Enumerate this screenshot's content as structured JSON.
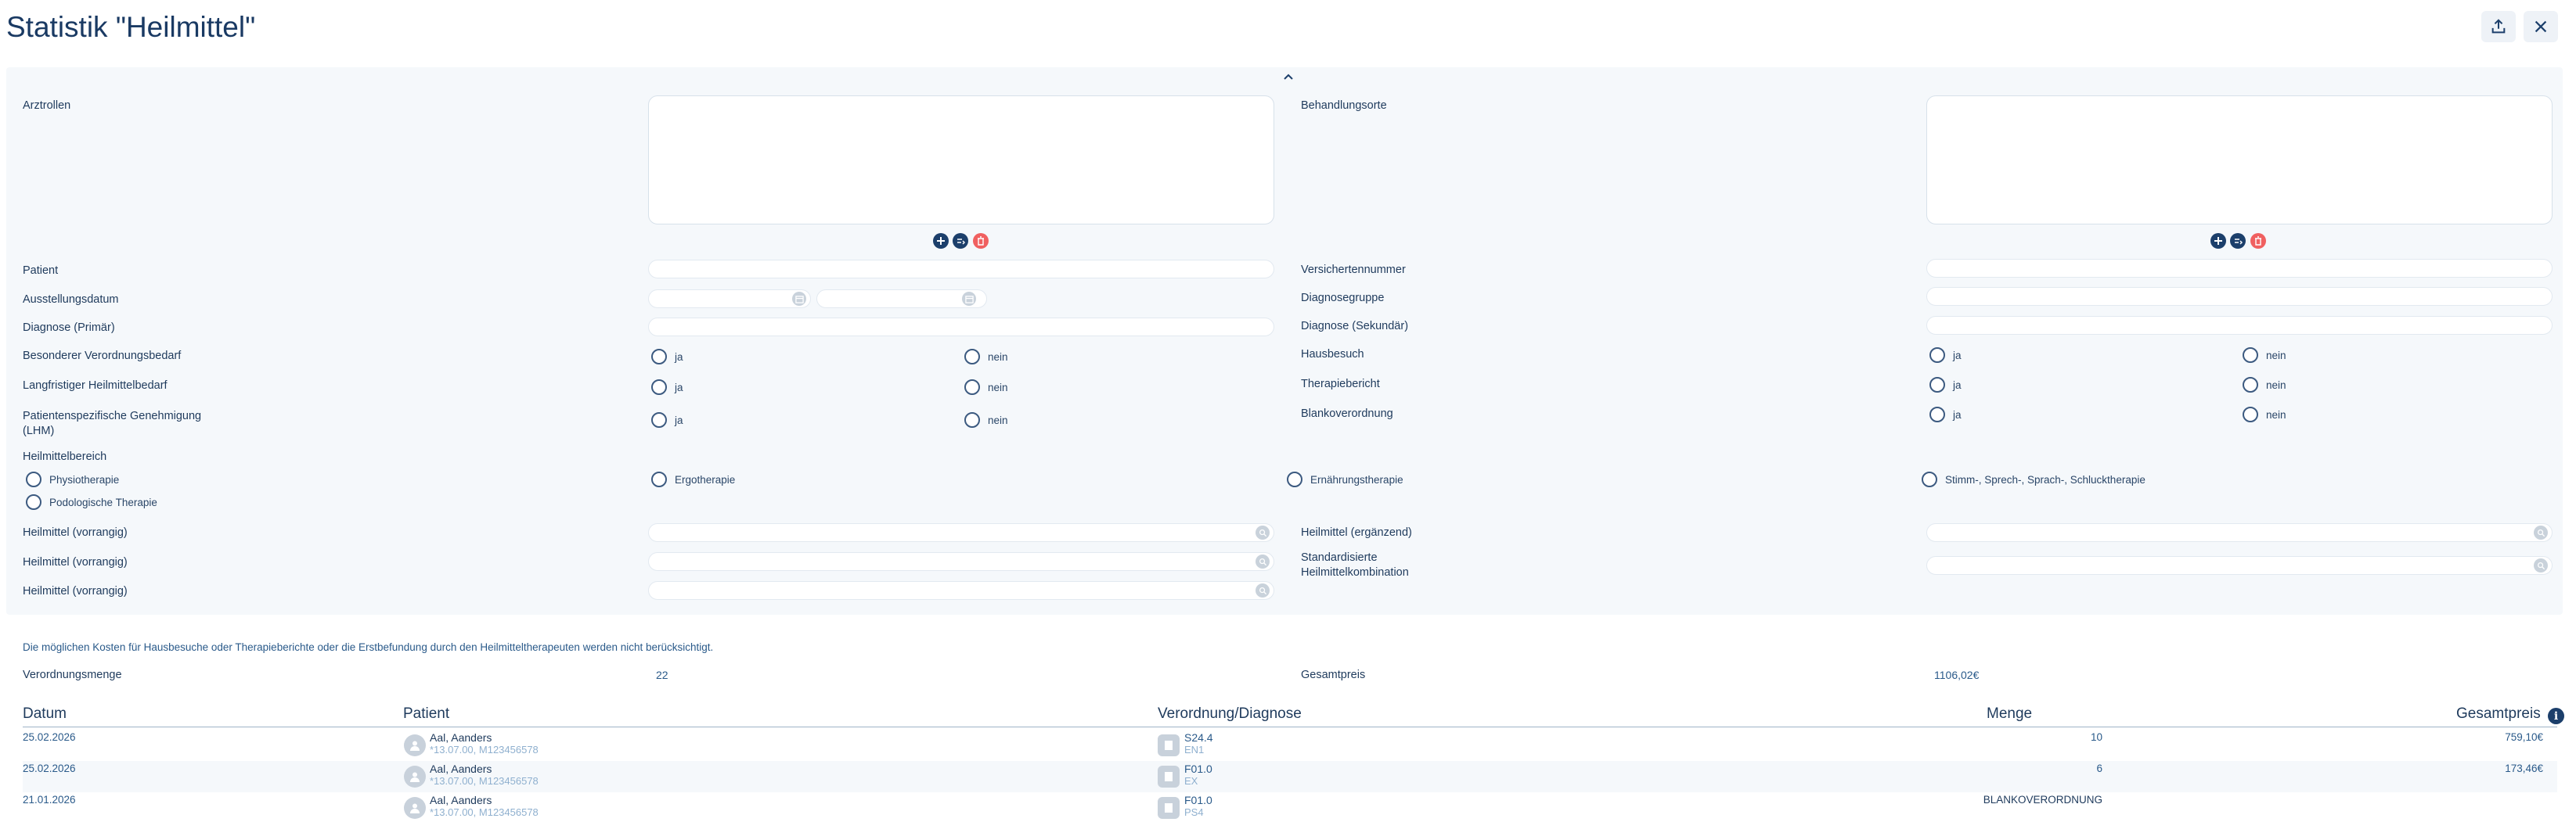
{
  "header": {
    "title": "Statistik \"Heilmittel\""
  },
  "filters": {
    "arztrollen": "Arztrollen",
    "behandlungsorte": "Behandlungsorte",
    "patient": "Patient",
    "versichertennummer": "Versichertennummer",
    "ausstellungsdatum": "Ausstellungsdatum",
    "diagnosegruppe": "Diagnosegruppe",
    "diagnose_primaer": "Diagnose (Primär)",
    "diagnose_sekundaer": "Diagnose (Sekundär)",
    "besonderer": "Besonderer Verordnungsbedarf",
    "hausbesuch": "Hausbesuch",
    "langfristiger": "Langfristiger Heilmittelbedarf",
    "therapiebericht": "Therapiebericht",
    "patientenspezifische": "Patientenspezifische Genehmigung (LHM)",
    "blankoverordnung": "Blankoverordnung",
    "heilmittelbereich": "Heilmittelbereich",
    "ja": "ja",
    "nein": "nein",
    "bereiche": [
      "Physiotherapie",
      "Ergotherapie",
      "Ernährungstherapie",
      "Stimm-, Sprech-, Sprach-, Schlucktherapie",
      "Podologische Therapie"
    ],
    "heilmittel_vorrangig": "Heilmittel (vorrangig)",
    "heilmittel_ergaenzend": "Heilmittel (ergänzend)",
    "standardisierte": "Standardisierte Heilmittelkombination"
  },
  "summary": {
    "note": "Die möglichen Kosten für Hausbesuche oder Therapieberichte oder die Erstbefundung durch den Heilmitteltherapeuten werden nicht berücksichtigt.",
    "verordnungsmenge_label": "Verordnungsmenge",
    "verordnungsmenge_value": "22",
    "gesamtpreis_label": "Gesamtpreis",
    "gesamtpreis_value": "1106,02€"
  },
  "table": {
    "headers": [
      "Datum",
      "Patient",
      "Verordnung/Diagnose",
      "Menge",
      "Gesamtpreis"
    ],
    "rows": [
      {
        "datum": "25.02.2026",
        "name": "Aal, Aanders",
        "info": "*13.07.00, M123456578",
        "code": "S24.4",
        "sub": "EN1",
        "menge": "10",
        "preis": "759,10€"
      },
      {
        "datum": "25.02.2026",
        "name": "Aal, Aanders",
        "info": "*13.07.00, M123456578",
        "code": "F01.0",
        "sub": "EX",
        "menge": "6",
        "preis": "173,46€"
      },
      {
        "datum": "21.01.2026",
        "name": "Aal, Aanders",
        "info": "*13.07.00, M123456578",
        "code": "F01.0",
        "sub": "PS4",
        "menge": "BLANKOVERORDNUNG",
        "preis": ""
      }
    ]
  },
  "icons": {
    "export": "export-icon",
    "close": "close-icon",
    "add": "add-icon",
    "edit": "edit-icon",
    "delete": "delete-icon",
    "calendar": "calendar-icon",
    "info": "info-icon"
  }
}
